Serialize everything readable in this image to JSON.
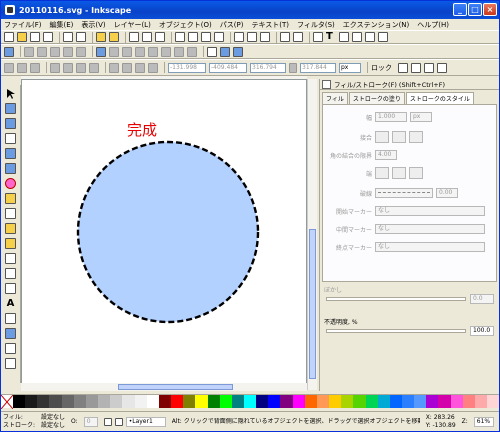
{
  "window": {
    "title": "20110116.svg - Inkscape"
  },
  "menu": [
    "ファイル(F)",
    "編集(E)",
    "表示(V)",
    "レイヤー(L)",
    "オブジェクト(O)",
    "パス(P)",
    "テキスト(T)",
    "フィルタ(S)",
    "エクステンション(N)",
    "ヘルプ(H)"
  ],
  "toolbar2": {
    "x": "-131.998",
    "y": "-409.484",
    "w": "316.794",
    "h": "317.844",
    "unit": "px",
    "lock_label": "ロック"
  },
  "canvas": {
    "label": "完成",
    "label_color": "#e60000",
    "circle_fill": "#b3d1ff",
    "circle_stroke": "#000000"
  },
  "panel": {
    "title": "フィル/ストローク(F) (Shift+Ctrl+F)",
    "tabs": [
      "フィル",
      "ストロークの塗り",
      "ストロークのスタイル"
    ],
    "width_label": "幅",
    "width_value": "1.000",
    "width_unit": "px",
    "join_label": "接合",
    "miter_label": "角の結合の限界",
    "miter_value": "4.00",
    "cap_label": "端",
    "dash_label": "破線",
    "dash_value": "0.00",
    "start_marker": "開始マーカー",
    "mid_marker": "中間マーカー",
    "end_marker": "終点マーカー",
    "none": "なし",
    "blur_label": "ぼかし",
    "blur_value": "0.0",
    "opacity_label": "不透明度, %",
    "opacity_value": "100.0"
  },
  "status": {
    "fill_label": "フィル:",
    "stroke_label": "ストローク:",
    "fill_value": "設定なし",
    "stroke_value": "設定なし",
    "o_label": "O:",
    "o_value": "0",
    "layer": "•Layer1",
    "message": "Alt: クリックで背面側に隠れているオブジェクトを選択、ドラッグで選択オブジェクトを移動させます",
    "x": "X: 283.26",
    "y": "Y: -130.89",
    "z_label": "Z:",
    "zoom": "61%"
  },
  "palette_colors": [
    "#000000",
    "#1a1a1a",
    "#333333",
    "#4d4d4d",
    "#666666",
    "#808080",
    "#999999",
    "#b3b3b3",
    "#cccccc",
    "#e6e6e6",
    "#f2f2f2",
    "#ffffff",
    "#800000",
    "#ff0000",
    "#808000",
    "#ffff00",
    "#008000",
    "#00ff00",
    "#008080",
    "#00ffff",
    "#000080",
    "#0000ff",
    "#800080",
    "#ff00ff",
    "#ff6600",
    "#ff9955",
    "#ffcc00",
    "#aad400",
    "#55d400",
    "#00d455",
    "#00aad4",
    "#0066ff",
    "#2a7fff",
    "#5599ff",
    "#aa00d4",
    "#d400aa",
    "#ff55dd",
    "#ff8080",
    "#ffaaaa",
    "#ffd5d5"
  ]
}
